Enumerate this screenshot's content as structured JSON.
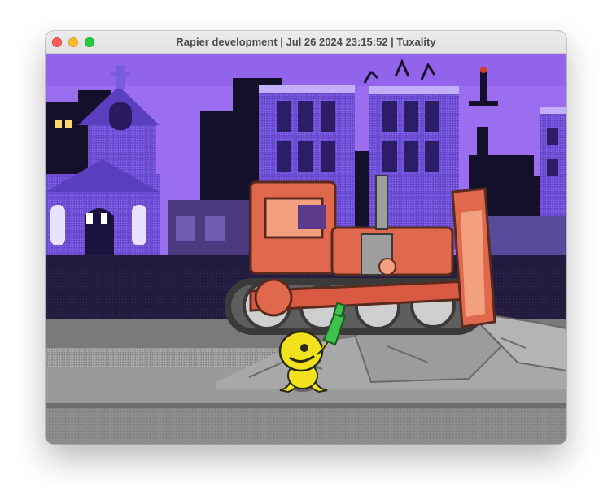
{
  "window": {
    "title": "Rapier development | Jul 26 2024 23:15:52 | Tuxality"
  },
  "scene": {
    "sky_color": "#9b6ef0",
    "player_color": "#f2e21d",
    "bulldozer_color": "#e0684d",
    "road_color": "#8c8c8c"
  }
}
